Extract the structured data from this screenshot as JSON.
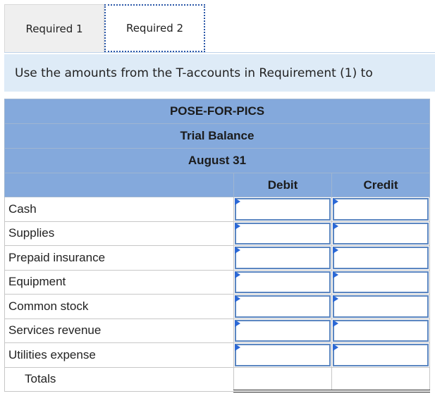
{
  "tabs": [
    {
      "label": "Required 1"
    },
    {
      "label": "Required 2"
    }
  ],
  "instruction": "Use the amounts from the T-accounts in Requirement (1) to",
  "trial_balance": {
    "company": "POSE-FOR-PICS",
    "title": "Trial Balance",
    "date": "August 31",
    "columns": {
      "debit": "Debit",
      "credit": "Credit"
    },
    "rows": [
      {
        "account": "Cash",
        "debit": "",
        "credit": ""
      },
      {
        "account": "Supplies",
        "debit": "",
        "credit": ""
      },
      {
        "account": "Prepaid insurance",
        "debit": "",
        "credit": ""
      },
      {
        "account": "Equipment",
        "debit": "",
        "credit": ""
      },
      {
        "account": "Common stock",
        "debit": "",
        "credit": ""
      },
      {
        "account": "Services revenue",
        "debit": "",
        "credit": ""
      },
      {
        "account": "Utilities expense",
        "debit": "",
        "credit": ""
      }
    ],
    "totals_label": "Totals"
  },
  "colors": {
    "header_blue": "#84a9dc",
    "instruction_bg": "#deebf7",
    "input_border": "#5b86c1"
  }
}
